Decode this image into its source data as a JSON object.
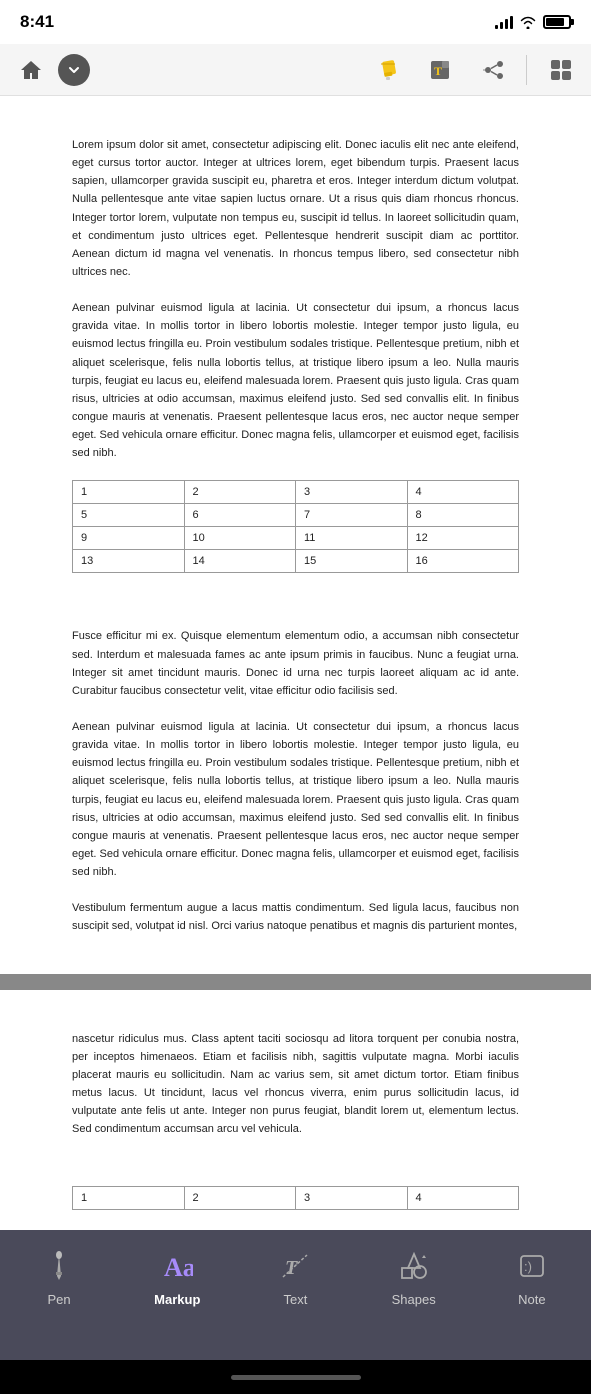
{
  "statusBar": {
    "time": "8:41"
  },
  "toolbar": {
    "homeLabel": "Home",
    "dropdownLabel": "Dropdown",
    "highlighterLabel": "Highlighter",
    "annotateLabel": "Annotate",
    "shareLabel": "Share",
    "moreLabel": "More"
  },
  "document": {
    "paragraphs": [
      "Lorem ipsum dolor sit amet, consectetur adipiscing elit. Donec iaculis elit nec ante eleifend, eget cursus tortor auctor. Integer at ultrices lorem, eget bibendum turpis. Praesent lacus sapien, ullamcorper gravida suscipit eu, pharetra et eros. Integer interdum dictum volutpat. Nulla pellentesque ante vitae sapien luctus ornare. Ut a risus quis diam rhoncus rhoncus. Integer tortor lorem, vulputate non tempus eu, suscipit id tellus. In laoreet sollicitudin quam, et condimentum justo ultrices eget. Pellentesque hendrerit suscipit diam ac porttitor. Aenean dictum id magna vel venenatis. In rhoncus tempus libero, sed consectetur nibh ultrices nec.",
      "Aenean pulvinar euismod ligula at lacinia. Ut consectetur dui ipsum, a rhoncus lacus gravida vitae. In mollis tortor in libero lobortis molestie. Integer tempor justo ligula, eu euismod lectus fringilla eu. Proin vestibulum sodales tristique. Pellentesque pretium, nibh et aliquet scelerisque, felis nulla lobortis tellus, at tristique libero ipsum a leo. Nulla mauris turpis, feugiat eu lacus eu, eleifend malesuada lorem. Praesent quis justo ligula. Cras quam risus, ultricies at odio accumsan, maximus eleifend justo. Sed sed convallis elit. In finibus congue mauris at venenatis. Praesent pellentesque lacus eros, nec auctor neque semper eget. Sed vehicula ornare efficitur. Donec magna felis, ullamcorper et euismod eget, facilisis sed nibh."
    ],
    "tableData": [
      [
        "1",
        "2",
        "3",
        "4"
      ],
      [
        "5",
        "6",
        "7",
        "8"
      ],
      [
        "9",
        "10",
        "11",
        "12"
      ],
      [
        "13",
        "14",
        "15",
        "16"
      ]
    ],
    "paragraphs2": [
      "Fusce efficitur mi ex. Quisque elementum elementum odio, a accumsan nibh consectetur sed. Interdum et malesuada fames ac ante ipsum primis in faucibus. Nunc a feugiat urna. Integer sit amet tincidunt mauris. Donec id urna nec turpis laoreet aliquam ac id ante. Curabitur faucibus consectetur velit, vitae efficitur odio facilisis sed.",
      "Aenean pulvinar euismod ligula at lacinia. Ut consectetur dui ipsum, a rhoncus lacus gravida vitae. In mollis tortor in libero lobortis molestie. Integer tempor justo ligula, eu euismod lectus fringilla eu. Proin vestibulum sodales tristique. Pellentesque pretium, nibh et aliquet scelerisque, felis nulla lobortis tellus, at tristique libero ipsum a leo. Nulla mauris turpis, feugiat eu lacus eu, eleifend malesuada lorem. Praesent quis justo ligula. Cras quam risus, ultricies at odio accumsan, maximus eleifend justo. Sed sed convallis elit. In finibus congue mauris at venenatis. Praesent pellentesque lacus eros, nec auctor neque semper eget. Sed vehicula ornare efficitur. Donec magna felis, ullamcorper et euismod eget, facilisis sed nibh.",
      "Vestibulum fermentum augue a lacus mattis condimentum. Sed ligula lacus, faucibus non suscipit sed, volutpat id nisl. Orci varius natoque penatibus et magnis dis parturient montes,"
    ],
    "paragraphs3": [
      "nascetur ridiculus mus. Class aptent taciti sociosqu ad litora torquent per conubia nostra, per inceptos himenaeos. Etiam et facilisis nibh, sagittis vulputate magna. Morbi iaculis placerat mauris eu sollicitudin. Nam ac varius sem, sit amet dictum tortor. Etiam finibus metus lacus. Ut tincidunt, lacus vel rhoncus viverra, enim purus sollicitudin lacus, id vulputate ante felis ut ante. Integer non purus feugiat, blandit lorem ut, elementum lectus. Sed condimentum accumsan arcu vel vehicula."
    ]
  },
  "bottomToolbar": {
    "tools": [
      {
        "id": "pen",
        "label": "Pen",
        "icon": "pen-icon",
        "active": false
      },
      {
        "id": "markup",
        "label": "Markup",
        "icon": "markup-icon",
        "active": true
      },
      {
        "id": "text",
        "label": "Text",
        "icon": "text-icon",
        "active": false
      },
      {
        "id": "shapes",
        "label": "Shapes",
        "icon": "shapes-icon",
        "active": false
      },
      {
        "id": "note",
        "label": "Note",
        "icon": "note-icon",
        "active": false
      }
    ]
  }
}
